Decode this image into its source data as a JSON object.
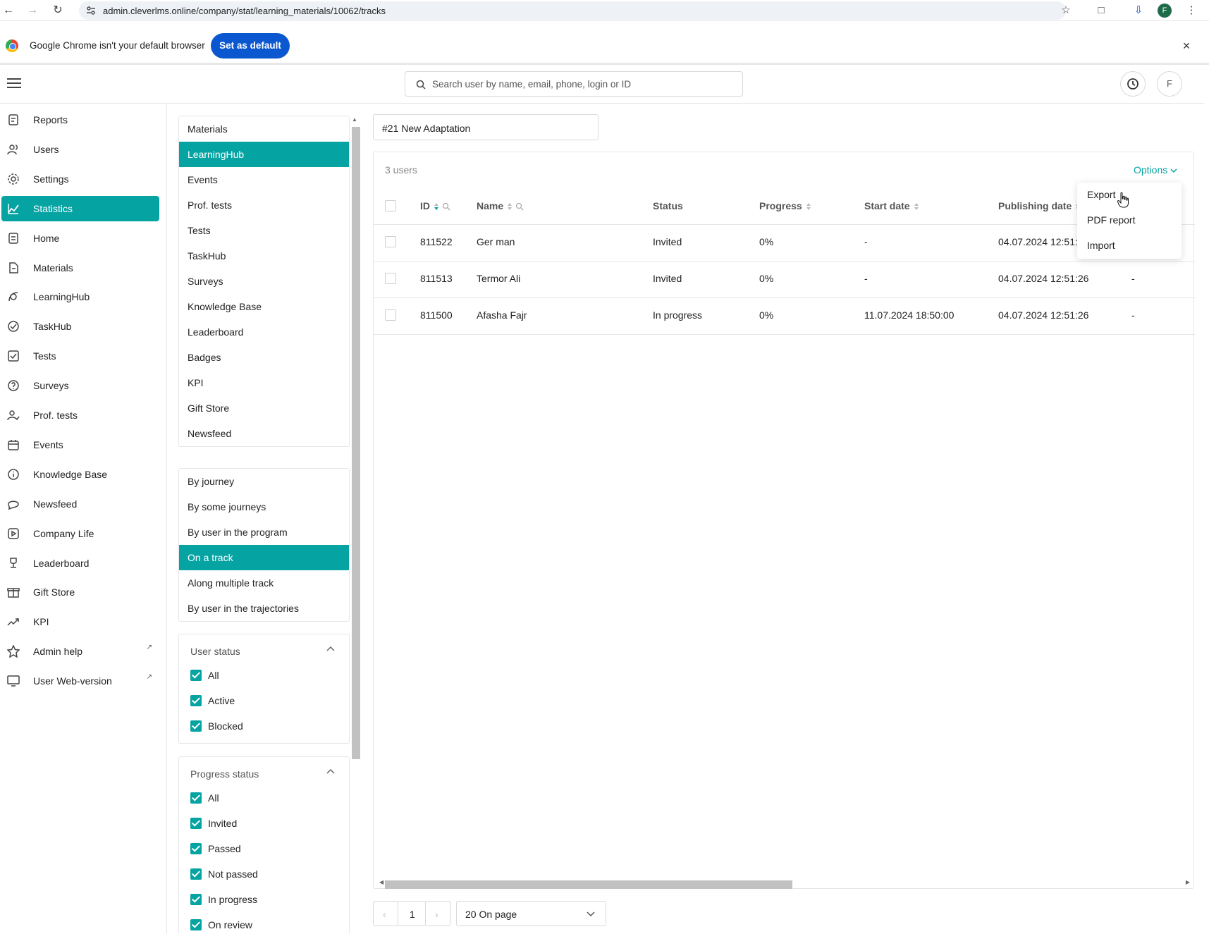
{
  "browser": {
    "url": "admin.cleverlms.online/company/stat/learning_materials/10062/tracks",
    "profile_initial": "F",
    "infobar_message": "Google Chrome isn't your default browser",
    "infobar_button": "Set as default"
  },
  "header": {
    "search_placeholder": "Search user by name, email, phone, login or ID",
    "avatar_initial": "F"
  },
  "sidebar": {
    "items": [
      {
        "label": "Reports",
        "icon": "report-icon"
      },
      {
        "label": "Users",
        "icon": "users-icon"
      },
      {
        "label": "Settings",
        "icon": "gear-icon"
      },
      {
        "label": "Statistics",
        "icon": "chart-line-icon",
        "active": true
      },
      {
        "label": "Home",
        "icon": "home-icon"
      },
      {
        "label": "Materials",
        "icon": "document-icon"
      },
      {
        "label": "LearningHub",
        "icon": "learninghub-icon"
      },
      {
        "label": "TaskHub",
        "icon": "check-circle-icon"
      },
      {
        "label": "Tests",
        "icon": "test-icon"
      },
      {
        "label": "Surveys",
        "icon": "question-icon"
      },
      {
        "label": "Prof. tests",
        "icon": "user-check-icon"
      },
      {
        "label": "Events",
        "icon": "calendar-icon"
      },
      {
        "label": "Knowledge Base",
        "icon": "info-icon"
      },
      {
        "label": "Newsfeed",
        "icon": "chat-icon"
      },
      {
        "label": "Company Life",
        "icon": "play-icon"
      },
      {
        "label": "Leaderboard",
        "icon": "trophy-icon"
      },
      {
        "label": "Gift Store",
        "icon": "gift-icon"
      },
      {
        "label": "KPI",
        "icon": "trend-icon"
      },
      {
        "label": "Admin help",
        "icon": "star-icon",
        "external": true
      },
      {
        "label": "User Web-version",
        "icon": "monitor-icon",
        "external": true
      }
    ]
  },
  "materials_filter": {
    "items": [
      "Materials",
      "LearningHub",
      "Events",
      "Prof. tests",
      "Tests",
      "TaskHub",
      "Surveys",
      "Knowledge Base",
      "Leaderboard",
      "Badges",
      "KPI",
      "Gift Store",
      "Newsfeed"
    ],
    "active": "LearningHub"
  },
  "report_type_filter": {
    "items": [
      "By journey",
      "By some journeys",
      "By user in the program",
      "On a track",
      "Along multiple track",
      "By user in the trajectories"
    ],
    "active": "On a track"
  },
  "user_status": {
    "title": "User status",
    "options": [
      "All",
      "Active",
      "Blocked"
    ]
  },
  "progress_status": {
    "title": "Progress status",
    "options": [
      "All",
      "Invited",
      "Passed",
      "Not passed",
      "In progress",
      "On review"
    ]
  },
  "main": {
    "track_value": "#21 New Adaptation",
    "user_count": "3 users",
    "options_label": "Options",
    "columns": [
      "ID",
      "Name",
      "Status",
      "Progress",
      "Start date",
      "Publishing date"
    ],
    "rows": [
      {
        "id": "811522",
        "name": "Ger man",
        "status": "Invited",
        "progress": "0%",
        "start": "-",
        "published": "04.07.2024 12:51:",
        "extra": ""
      },
      {
        "id": "811513",
        "name": "Termor Ali",
        "status": "Invited",
        "progress": "0%",
        "start": "-",
        "published": "04.07.2024 12:51:26",
        "extra": "-"
      },
      {
        "id": "811500",
        "name": "Afasha Fajr",
        "status": "In progress",
        "progress": "0%",
        "start": "11.07.2024 18:50:00",
        "published": "04.07.2024 12:51:26",
        "extra": "-"
      }
    ],
    "dropdown": [
      "Export",
      "PDF report",
      "Import"
    ],
    "pagination": {
      "page": "1",
      "page_size": "20 On page"
    }
  },
  "colors": {
    "accent": "#06a3a3",
    "chrome_blue": "#0b57d0"
  }
}
